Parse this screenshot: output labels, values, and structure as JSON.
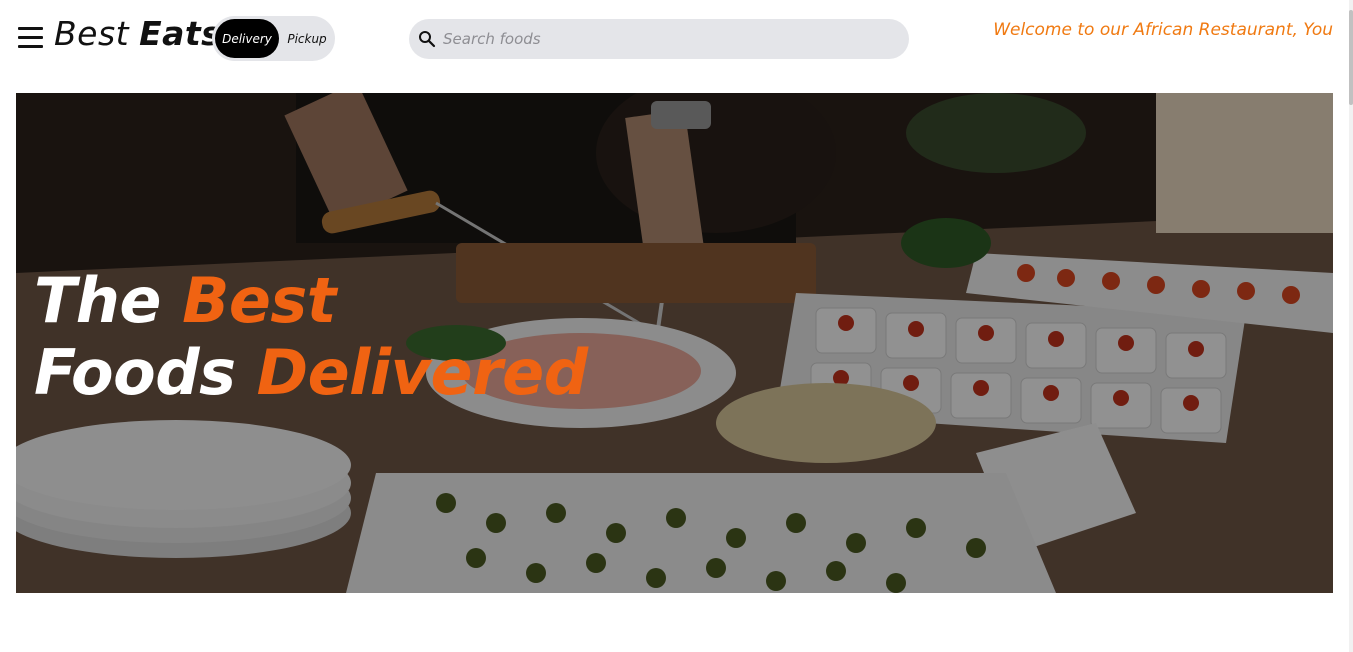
{
  "header": {
    "brand_first": "Best",
    "brand_second": "Eats",
    "toggle": {
      "delivery_label": "Delivery",
      "pickup_label": "Pickup",
      "selected": "Delivery"
    },
    "search": {
      "placeholder": "Search foods",
      "value": ""
    },
    "welcome_text": "Welcome to our African Restaurant, You"
  },
  "hero": {
    "line1_white": "The",
    "line1_accent": "Best",
    "line2_white": "Foods",
    "line2_accent": "Delivered"
  },
  "icons": {
    "menu": "hamburger-menu-icon",
    "search": "magnifier-search-icon"
  },
  "colors": {
    "accent": "#f06312",
    "welcome": "#f07a12",
    "toggle_bg": "#e4e5e9",
    "toggle_active": "#000000",
    "search_bg": "#e4e5e9"
  }
}
